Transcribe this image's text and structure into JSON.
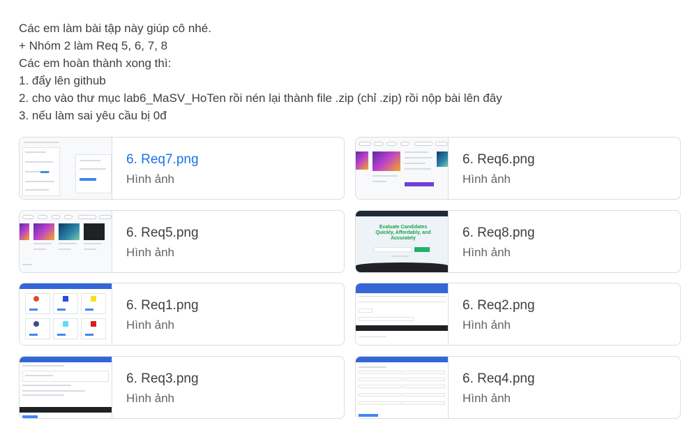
{
  "instructions": {
    "lines": [
      "Các em làm bài tập này giúp cô nhé.",
      "+ Nhóm 2 làm Req 5, 6, 7, 8",
      "Các em hoàn thành xong thì:",
      "1. đẩy lên github",
      "2. cho vào thư mục lab6_MaSV_HoTen rồi nén lại thành file .zip (chỉ .zip) rồi nộp bài lên đây",
      "3. nếu làm sai yêu cầu bị 0đ"
    ]
  },
  "attachments": [
    {
      "title": "6. Req7.png",
      "type": "Hình ảnh",
      "active": true,
      "thumb": "form-list"
    },
    {
      "title": "6. Req6.png",
      "type": "Hình ảnh",
      "active": false,
      "thumb": "course-detail"
    },
    {
      "title": "6. Req5.png",
      "type": "Hình ảnh",
      "active": false,
      "thumb": "course-grid"
    },
    {
      "title": "6. Req8.png",
      "type": "Hình ảnh",
      "active": false,
      "thumb": "landing-page"
    },
    {
      "title": "6. Req1.png",
      "type": "Hình ảnh",
      "active": false,
      "thumb": "logo-grid"
    },
    {
      "title": "6. Req2.png",
      "type": "Hình ảnh",
      "active": false,
      "thumb": "table-form"
    },
    {
      "title": "6. Req3.png",
      "type": "Hình ảnh",
      "active": false,
      "thumb": "editor-form"
    },
    {
      "title": "6. Req4.png",
      "type": "Hình ảnh",
      "active": false,
      "thumb": "field-form"
    }
  ],
  "thumb_text": {
    "landing_headline": "Evaluate Candidates Quickly, Affordably, and Accurately"
  },
  "colors": {
    "active_title": "#1a73e8",
    "border": "#dadce0",
    "text": "#3c4043",
    "subtext": "#5f6368"
  }
}
